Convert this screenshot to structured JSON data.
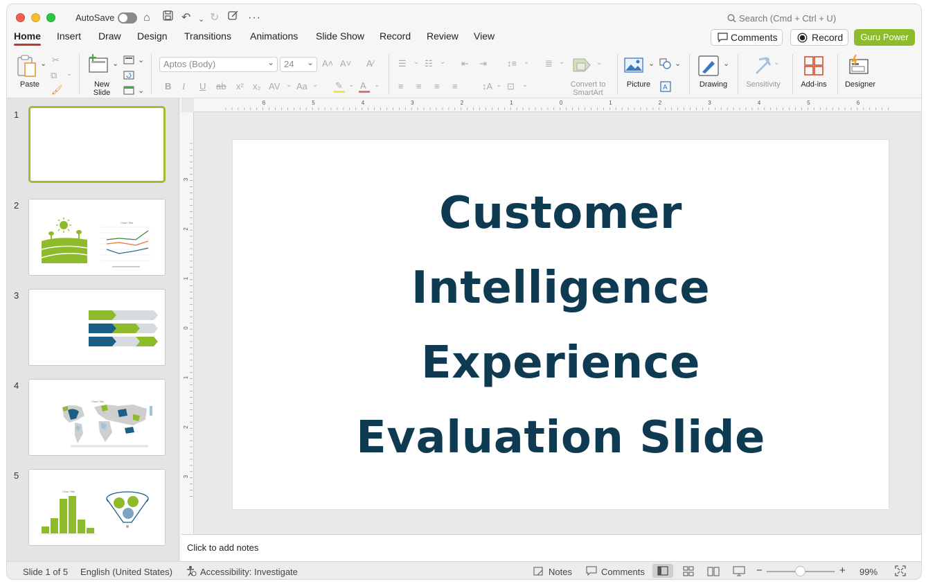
{
  "titlebar": {
    "autosave_label": "AutoSave",
    "search_placeholder": "Search (Cmd + Ctrl + U)"
  },
  "tabs": [
    {
      "label": "Home",
      "active": true
    },
    {
      "label": "Insert"
    },
    {
      "label": "Draw"
    },
    {
      "label": "Design"
    },
    {
      "label": "Transitions"
    },
    {
      "label": "Animations"
    },
    {
      "label": "Slide Show"
    },
    {
      "label": "Record"
    },
    {
      "label": "Review"
    },
    {
      "label": "View"
    }
  ],
  "actions": {
    "comments": "Comments",
    "record": "Record",
    "guru_power": "Guru Power"
  },
  "ribbon": {
    "paste": "Paste",
    "new_slide": "New\nSlide",
    "font_name": "Aptos (Body)",
    "font_size": "24",
    "convert_to_smartart": "Convert to\nSmartArt",
    "picture": "Picture",
    "drawing": "Drawing",
    "sensitivity": "Sensitivity",
    "add_ins": "Add-ins",
    "designer": "Designer"
  },
  "slides": [
    {
      "number": "1",
      "selected": true
    },
    {
      "number": "2"
    },
    {
      "number": "3"
    },
    {
      "number": "4"
    },
    {
      "number": "5"
    }
  ],
  "slide": {
    "title_lines": [
      "Customer",
      "Intelligence",
      "Experience",
      "Evaluation Slide"
    ]
  },
  "ruler": {
    "h_labels": [
      "6",
      "5",
      "4",
      "3",
      "2",
      "1",
      "0",
      "1",
      "2",
      "3",
      "4",
      "5",
      "6"
    ],
    "v_labels": [
      "3",
      "2",
      "1",
      "0",
      "1",
      "2",
      "3"
    ]
  },
  "notes_placeholder": "Click to add notes",
  "status": {
    "slide_count": "Slide 1 of 5",
    "language": "English (United States)",
    "accessibility": "Accessibility: Investigate",
    "notes": "Notes",
    "comments": "Comments",
    "zoom": "99%"
  },
  "colors": {
    "accent": "#8dbb2c",
    "title": "#0e3a52",
    "tab_underline": "#c0392b"
  }
}
